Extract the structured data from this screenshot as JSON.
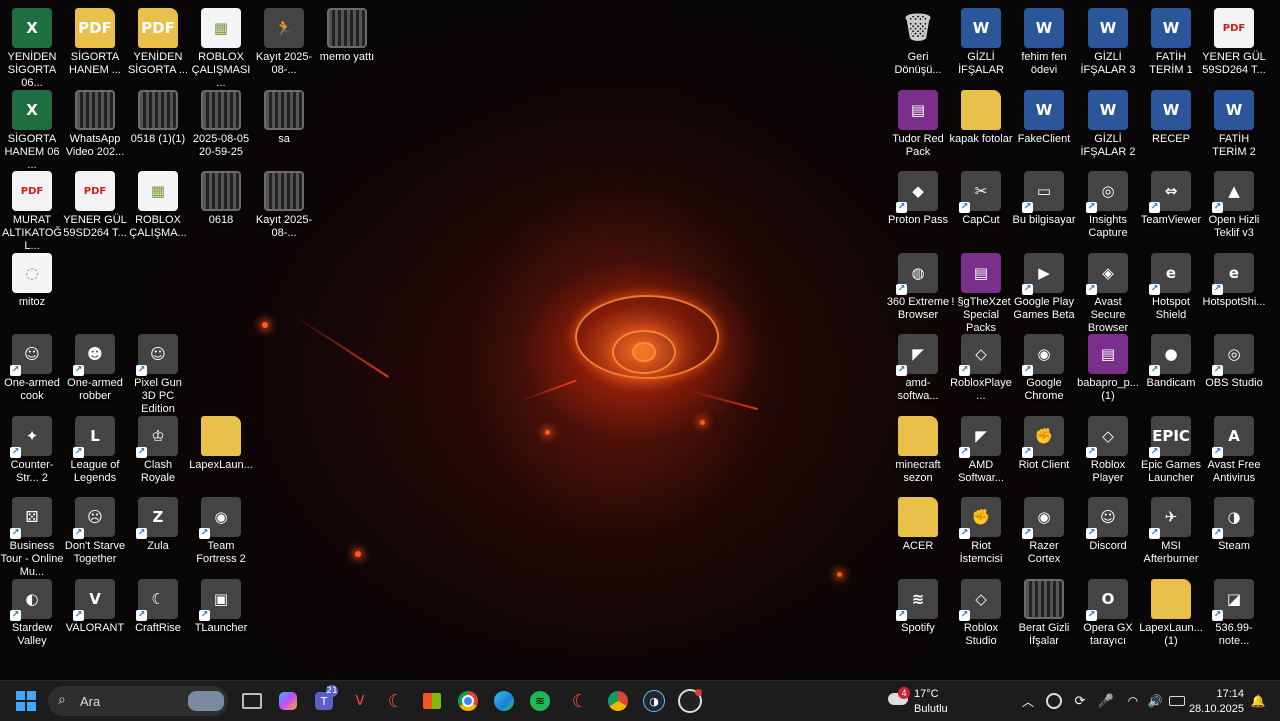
{
  "desktop": {
    "left_icons": [
      {
        "label": "YENİDEN SİGORTA 06...",
        "type": "excel",
        "glyph": "X"
      },
      {
        "label": "SİGORTA HANEM ...",
        "type": "folder",
        "glyph": "PDF"
      },
      {
        "label": "YENİDEN SİGORTA ...",
        "type": "folder",
        "glyph": "PDF"
      },
      {
        "label": "ROBLOX ÇALIŞMASI ...",
        "type": "image",
        "glyph": "▦"
      },
      {
        "label": "Kayıt 2025-08-...",
        "type": "app",
        "glyph": "🏃"
      },
      {
        "label": "memo yattı",
        "type": "video",
        "glyph": ""
      },
      {
        "label": "SİGORTA HANEM 06 ...",
        "type": "excel",
        "glyph": "X"
      },
      {
        "label": "WhatsApp Video 202...",
        "type": "video",
        "glyph": ""
      },
      {
        "label": "0518 (1)(1)",
        "type": "video",
        "glyph": ""
      },
      {
        "label": "2025-08-05 20-59-25",
        "type": "video",
        "glyph": ""
      },
      {
        "label": "sa",
        "type": "video",
        "glyph": ""
      },
      {
        "label": "MURAT ALTIKATOĞL...",
        "type": "pdf",
        "glyph": "PDF"
      },
      {
        "label": "YENER GÜL 59SD264 T...",
        "type": "pdf",
        "glyph": "PDF"
      },
      {
        "label": "ROBLOX ÇALIŞMA...",
        "type": "image",
        "glyph": "▦"
      },
      {
        "label": "0618",
        "type": "video",
        "glyph": ""
      },
      {
        "label": "Kayıt 2025-08-...",
        "type": "video",
        "glyph": ""
      },
      {
        "label": "mitoz",
        "type": "image",
        "glyph": "◌"
      },
      {
        "label": "One-armed cook",
        "type": "app",
        "glyph": "☺"
      },
      {
        "label": "One-armed robber",
        "type": "app",
        "glyph": "☻"
      },
      {
        "label": "Pixel Gun 3D PC Edition",
        "type": "app",
        "glyph": "☺"
      },
      {
        "label": "Counter-Str... 2",
        "type": "app",
        "glyph": "✦"
      },
      {
        "label": "League of Legends",
        "type": "app",
        "glyph": "L"
      },
      {
        "label": "Clash Royale",
        "type": "app",
        "glyph": "♔"
      },
      {
        "label": "LapexLaun...",
        "type": "folder",
        "glyph": ""
      },
      {
        "label": "Business Tour - Online Mu...",
        "type": "app",
        "glyph": "⚄"
      },
      {
        "label": "Don't Starve Together",
        "type": "app",
        "glyph": "☹"
      },
      {
        "label": "Zula",
        "type": "app",
        "glyph": "Z"
      },
      {
        "label": "Team Fortress 2",
        "type": "app",
        "glyph": "◉"
      },
      {
        "label": "Stardew Valley",
        "type": "app",
        "glyph": "◐"
      },
      {
        "label": "VALORANT",
        "type": "app",
        "glyph": "V"
      },
      {
        "label": "CraftRise",
        "type": "app",
        "glyph": "☾"
      },
      {
        "label": "TLauncher",
        "type": "app",
        "glyph": "▣"
      }
    ],
    "right_icons": [
      {
        "label": "Geri Dönüşü...",
        "type": "bin",
        "glyph": "🗑"
      },
      {
        "label": "GİZLİ İFŞALAR",
        "type": "word",
        "glyph": "W"
      },
      {
        "label": "fehim fen ödevi",
        "type": "word",
        "glyph": "W"
      },
      {
        "label": "GİZLİ İFŞALAR 3",
        "type": "word",
        "glyph": "W"
      },
      {
        "label": "FATİH TERİM 1",
        "type": "word",
        "glyph": "W"
      },
      {
        "label": "YENER GÜL 59SD264 T...",
        "type": "pdf",
        "glyph": "PDF"
      },
      {
        "label": "Tudor Red Pack",
        "type": "rar",
        "glyph": "▤"
      },
      {
        "label": "kapak fotolar",
        "type": "folder",
        "glyph": ""
      },
      {
        "label": "FakeClient",
        "type": "word",
        "glyph": "W"
      },
      {
        "label": "GİZLİ İFŞALAR 2",
        "type": "word",
        "glyph": "W"
      },
      {
        "label": "RECEP",
        "type": "word",
        "glyph": "W"
      },
      {
        "label": "FATİH TERİM 2",
        "type": "word",
        "glyph": "W"
      },
      {
        "label": "Proton Pass",
        "type": "app",
        "glyph": "◆"
      },
      {
        "label": "CapCut",
        "type": "app",
        "glyph": "✂"
      },
      {
        "label": "Bu bilgisayar",
        "type": "app",
        "glyph": "▭"
      },
      {
        "label": "Insights Capture",
        "type": "app",
        "glyph": "◎"
      },
      {
        "label": "TeamViewer",
        "type": "app",
        "glyph": "⇔"
      },
      {
        "label": "Open Hizli Teklif v3",
        "type": "app",
        "glyph": "▲"
      },
      {
        "label": "360 Extreme Browser",
        "type": "app",
        "glyph": "◍"
      },
      {
        "label": "! §gTheXzet Special Packs",
        "type": "rar",
        "glyph": "▤"
      },
      {
        "label": "Google Play Games Beta",
        "type": "app",
        "glyph": "▶"
      },
      {
        "label": "Avast Secure Browser",
        "type": "app",
        "glyph": "◈"
      },
      {
        "label": "Hotspot Shield",
        "type": "app",
        "glyph": "e"
      },
      {
        "label": "HotspotShi...",
        "type": "app",
        "glyph": "e"
      },
      {
        "label": "amd-softwa...",
        "type": "app",
        "glyph": "◤"
      },
      {
        "label": "RobloxPlaye...",
        "type": "app",
        "glyph": "◇"
      },
      {
        "label": "Google Chrome",
        "type": "app",
        "glyph": "◉"
      },
      {
        "label": "babapro_p... (1)",
        "type": "rar",
        "glyph": "▤"
      },
      {
        "label": "Bandicam",
        "type": "app",
        "glyph": "●"
      },
      {
        "label": "OBS Studio",
        "type": "app",
        "glyph": "◎"
      },
      {
        "label": "minecraft sezon",
        "type": "folder",
        "glyph": ""
      },
      {
        "label": "AMD Softwar...",
        "type": "app",
        "glyph": "◤"
      },
      {
        "label": "Riot Client",
        "type": "app",
        "glyph": "✊"
      },
      {
        "label": "Roblox Player",
        "type": "app",
        "glyph": "◇"
      },
      {
        "label": "Epic Games Launcher",
        "type": "app",
        "glyph": "EPIC"
      },
      {
        "label": "Avast Free Antivirus",
        "type": "app",
        "glyph": "A"
      },
      {
        "label": "ACER",
        "type": "folder",
        "glyph": ""
      },
      {
        "label": "Riot İstemcisi",
        "type": "app",
        "glyph": "✊"
      },
      {
        "label": "Razer Cortex",
        "type": "app",
        "glyph": "◉"
      },
      {
        "label": "Discord",
        "type": "app",
        "glyph": "☺"
      },
      {
        "label": "MSI Afterburner",
        "type": "app",
        "glyph": "✈"
      },
      {
        "label": "Steam",
        "type": "app",
        "glyph": "◑"
      },
      {
        "label": "Spotify",
        "type": "app",
        "glyph": "≋"
      },
      {
        "label": "Roblox Studio",
        "type": "app",
        "glyph": "◇"
      },
      {
        "label": "Berat Gizli İfşalar",
        "type": "video",
        "glyph": ""
      },
      {
        "label": "Opera GX tarayıcı",
        "type": "app",
        "glyph": "O"
      },
      {
        "label": "LapexLaun... (1)",
        "type": "folder",
        "glyph": ""
      },
      {
        "label": "536.99-note...",
        "type": "app",
        "glyph": "◪"
      }
    ]
  },
  "taskbar": {
    "search_placeholder": "Ara",
    "teams_badge": "21",
    "weather_badge": "4",
    "temperature": "17°C",
    "weather_condition": "Bulutlu",
    "time": "17:14",
    "date": "28.10.2025"
  },
  "colors": {
    "taskbar_bg": "#1c1c1c",
    "excel": "#1d6f42",
    "word": "#2b579a",
    "pdf": "#d11b1b",
    "folder": "#e8c04a",
    "rar": "#7a2f8a"
  }
}
